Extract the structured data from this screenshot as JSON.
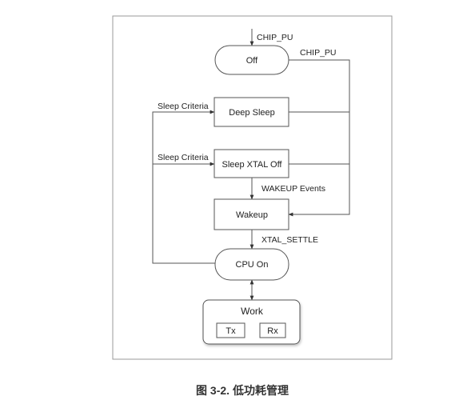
{
  "diagram": {
    "nodes": {
      "off": "Off",
      "deep_sleep": "Deep Sleep",
      "sleep_xtal_off": "Sleep XTAL Off",
      "wakeup": "Wakeup",
      "cpu_on": "CPU On",
      "work": "Work",
      "tx": "Tx",
      "rx": "Rx"
    },
    "edge_labels": {
      "chip_pu_entry": "CHIP_PU",
      "chip_pu_loop": "CHIP_PU",
      "sleep_criteria_deep": "Sleep Criteria",
      "sleep_criteria_xtal": "Sleep Criteria",
      "wakeup_events": "WAKEUP Events",
      "xtal_settle": "XTAL_SETTLE"
    }
  },
  "caption": "图 3-2. 低功耗管理"
}
